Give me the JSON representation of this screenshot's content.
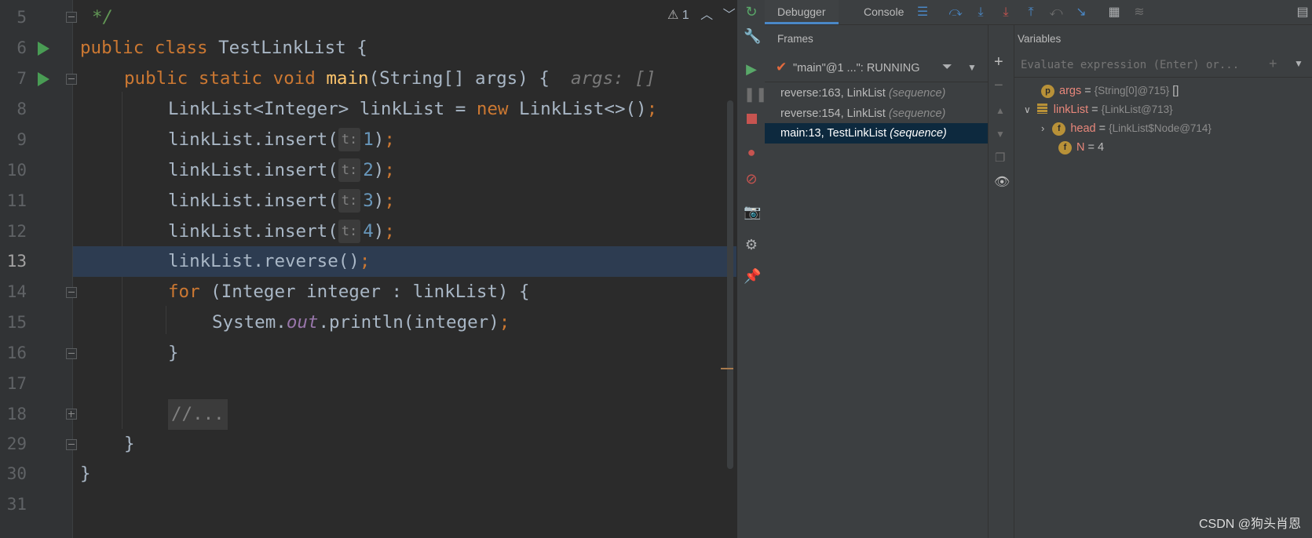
{
  "editor": {
    "lines": [
      {
        "num": "5"
      },
      {
        "num": "6"
      },
      {
        "num": "7"
      },
      {
        "num": "8"
      },
      {
        "num": "9"
      },
      {
        "num": "10"
      },
      {
        "num": "11"
      },
      {
        "num": "12"
      },
      {
        "num": "13"
      },
      {
        "num": "14"
      },
      {
        "num": "15"
      },
      {
        "num": "16"
      },
      {
        "num": "17"
      },
      {
        "num": "18"
      },
      {
        "num": "29"
      },
      {
        "num": "30"
      },
      {
        "num": "31"
      }
    ],
    "tokens": {
      "comment_end": "*/",
      "public": "public",
      "class": "class",
      "class_name": "TestLinkList {",
      "static": "static",
      "void": "void",
      "main": "main",
      "main_params": "(String[] args) {",
      "args_hint": "args: []",
      "decl_left": "LinkList<Integer> linkList = ",
      "new": "new",
      "decl_right": " LinkList<>()",
      "semicolon": ";",
      "insert_call": "linkList.insert(",
      "param_hint": "t:",
      "insert_values": [
        "1",
        "2",
        "3",
        "4"
      ],
      "close_paren": ")",
      "reverse_call": "linkList.reverse()",
      "for": "for",
      "for_body": " (Integer integer : linkList) {",
      "sys_out_a": "System.",
      "sys_out_field": "out",
      "sys_out_b": ".println(integer)",
      "close_brace": "}",
      "folded_comment": "//..."
    },
    "warning_count": "1"
  },
  "debugger": {
    "tabs": [
      "Debugger",
      "Console"
    ],
    "frames_title": "Frames",
    "thread_label": "\"main\"@1 ...\": RUNNING",
    "frames": [
      {
        "method": "reverse:163, LinkList",
        "tag": "(sequence)"
      },
      {
        "method": "reverse:154, LinkList",
        "tag": "(sequence)"
      },
      {
        "method": "main:13, TestLinkList",
        "tag": "(sequence)"
      }
    ],
    "variables_title": "Variables",
    "eval_placeholder": "Evaluate expression (Enter) or...",
    "variables": [
      {
        "badge": "p",
        "name": "args",
        "eq": " = ",
        "value": "{String[0]@715}",
        "extra": " []"
      },
      {
        "badge": "",
        "name": "linkList",
        "eq": " = ",
        "value": "{LinkList@713}",
        "extra": ""
      },
      {
        "badge": "f",
        "name": "head",
        "eq": " = ",
        "value": "{LinkList$Node@714}",
        "extra": ""
      },
      {
        "badge": "f",
        "name": "N",
        "eq": " = ",
        "value": "4",
        "extra": ""
      }
    ]
  },
  "watermark": "CSDN @狗头肖恩",
  "colors": {
    "accent": "#4a88c7",
    "selection": "#0d293e",
    "keyword": "#cc7832",
    "run": "#499c54"
  }
}
